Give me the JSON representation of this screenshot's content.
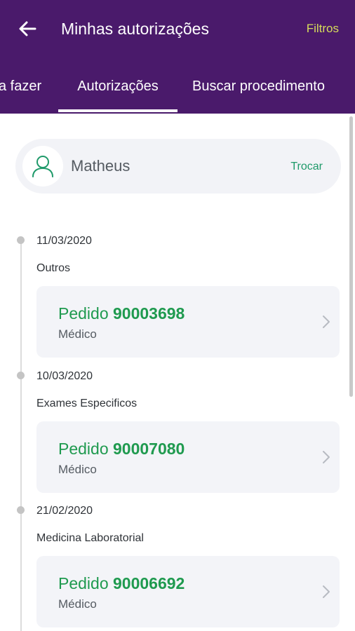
{
  "header": {
    "title": "Minhas autorizações",
    "filters_label": "Filtros",
    "back_icon": "arrow-left-icon",
    "background_color": "#4a1a6b",
    "accent_color": "#d6dc5a"
  },
  "tabs": [
    {
      "label": "a fazer",
      "active": false
    },
    {
      "label": "Autorizações",
      "active": true
    },
    {
      "label": "Buscar procedimento",
      "active": false
    }
  ],
  "user": {
    "name": "Matheus",
    "switch_label": "Trocar",
    "avatar_icon": "user-icon"
  },
  "timeline": [
    {
      "date": "11/03/2020",
      "category": "Outros",
      "order_prefix": "Pedido",
      "order_number": "90003698",
      "type": "Médico"
    },
    {
      "date": "10/03/2020",
      "category": "Exames Especificos",
      "order_prefix": "Pedido",
      "order_number": "90007080",
      "type": "Médico"
    },
    {
      "date": "21/02/2020",
      "category": "Medicina Laboratorial",
      "order_prefix": "Pedido",
      "order_number": "90006692",
      "type": "Médico"
    }
  ],
  "colors": {
    "green_accent": "#1f9a4f",
    "card_background": "#f3f4f8"
  }
}
